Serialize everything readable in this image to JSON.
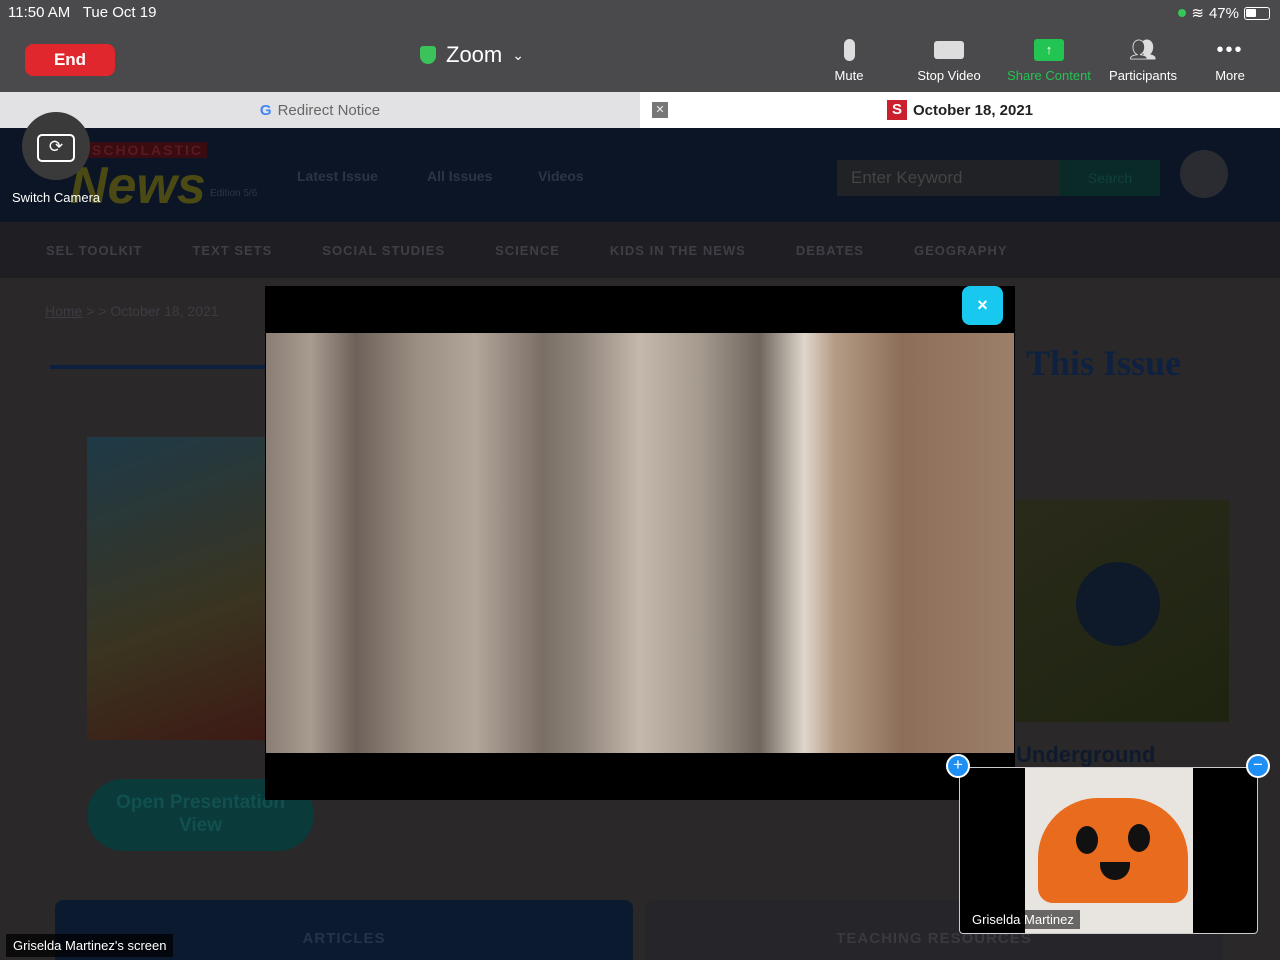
{
  "status": {
    "time": "11:50 AM",
    "date": "Tue Oct 19",
    "battery": "47%"
  },
  "toolbar": {
    "end": "End",
    "title": "Zoom",
    "controls": [
      {
        "label": "Mute",
        "icon": "microphone-icon"
      },
      {
        "label": "Stop Video",
        "icon": "video-camera-icon"
      },
      {
        "label": "Share Content",
        "icon": "share-icon"
      },
      {
        "label": "Participants",
        "icon": "participants-icon"
      },
      {
        "label": "More",
        "icon": "more-icon"
      }
    ]
  },
  "tabs": [
    {
      "label": "Redirect Notice"
    },
    {
      "label": "October 18, 2021"
    }
  ],
  "camera": {
    "label": "Switch Camera"
  },
  "site": {
    "logo_top": "SCHOLASTIC",
    "logo": "News",
    "edition": "Edition 5/6",
    "nav": [
      "Latest Issue",
      "All Issues",
      "Videos"
    ],
    "search_placeholder": "Enter Keyword",
    "search_btn": "Search",
    "menu": [
      "SEL TOOLKIT",
      "TEXT SETS",
      "SOCIAL STUDIES",
      "SCIENCE",
      "KIDS IN THE NEWS",
      "DEBATES",
      "GEOGRAPHY"
    ],
    "breadcrumb_home": "Home",
    "breadcrumb_rest": "> > October 18, 2021",
    "this_issue": "This Issue",
    "underground": "Underground",
    "open_view": "Open Presentation View",
    "articles": "ARTICLES",
    "teaching": "TEACHING RESOURCES"
  },
  "modal": {
    "close": "×"
  },
  "pip": {
    "name": "Griselda Martinez",
    "add": "+",
    "minimize": "−"
  },
  "screen_label": "Griselda Martinez's screen",
  "colors": {
    "end": "#e0272d",
    "share": "#23c552",
    "close": "#19c8ef"
  }
}
